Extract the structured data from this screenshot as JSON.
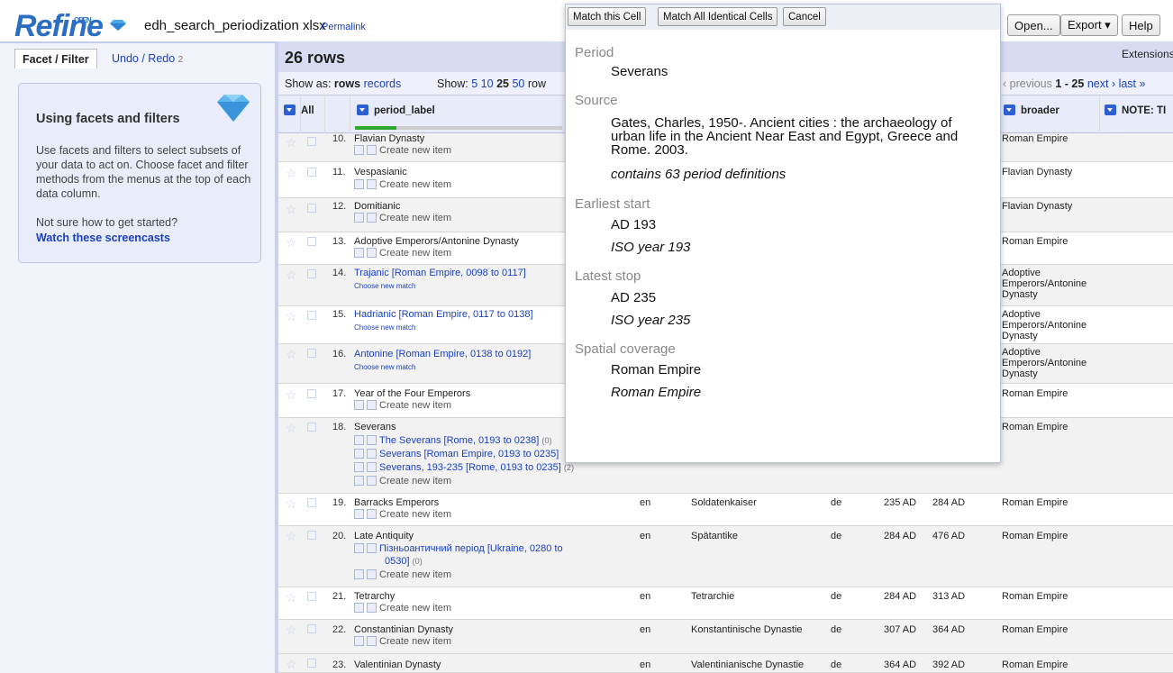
{
  "app": {
    "logo": "Refine",
    "logo_small": "OPEN",
    "project_name": "edh_search_periodization xlsx",
    "permalink": "Permalink"
  },
  "top_buttons": {
    "open": "Open...",
    "export": "Export ▾",
    "help": "Help"
  },
  "left": {
    "tab_facet": "Facet / Filter",
    "tab_undo": "Undo / Redo",
    "undo_count": "2",
    "help_title": "Using facets and filters",
    "help_text": "Use facets and filters to select subsets of your data to act on. Choose facet and filter methods from the menus at the top of each data column.",
    "help_q": "Not sure how to get started?",
    "help_link": "Watch these screencasts"
  },
  "grid": {
    "row_count": "26 rows",
    "show_as_label": "Show as:",
    "show_as_rows": "rows",
    "show_as_records": "records",
    "show_label": "Show:",
    "show_5": "5",
    "show_10": "10",
    "show_25": "25",
    "show_50": "50",
    "show_row": "row",
    "pager_prev": "‹ previous",
    "pager_range": "1 - 25",
    "pager_next": "next ›",
    "pager_last": "last »",
    "extensions": "Extensions:",
    "col_all": "All",
    "col_period": "period_label",
    "col_broader": "broader",
    "col_note": "NOTE: TI",
    "reconcile_progress": 0.2
  },
  "rows": [
    {
      "num": "10.",
      "label": "Flavian Dynasty",
      "sub": "Create new item",
      "broader": "Roman Empire"
    },
    {
      "num": "11.",
      "label": "Vespasianic",
      "sub": "Create new item",
      "broader": "Flavian Dynasty"
    },
    {
      "num": "12.",
      "label": "Domitianic",
      "sub": "Create new item",
      "broader": "Flavian Dynasty"
    },
    {
      "num": "13.",
      "label": "Adoptive Emperors/Antonine Dynasty",
      "sub": "Create new item",
      "broader": "Roman Empire"
    },
    {
      "num": "14.",
      "label": "Trajanic [Roman Empire, 0098 to 0117]",
      "sub": "Choose new match",
      "broader": "Adoptive Emperors/Antonine Dynasty"
    },
    {
      "num": "15.",
      "label": "Hadrianic [Roman Empire, 0117 to 0138]",
      "sub": "Choose new match",
      "broader": "Adoptive Emperors/Antonine Dynasty"
    },
    {
      "num": "16.",
      "label": "Antonine [Roman Empire, 0138 to 0192]",
      "sub": "Choose new match",
      "broader": "Adoptive Emperors/Antonine Dynasty"
    },
    {
      "num": "17.",
      "label": "Year of the Four Emperors",
      "sub": "Create new item",
      "broader": "Roman Empire"
    },
    {
      "num": "18.",
      "label": "Severans",
      "cand1": "The Severans [Rome, 0193 to 0238]",
      "cand1_score": "(0)",
      "cand2": "Severans [Roman Empire, 0193 to 0235]",
      "cand3": "Severans, 193-235 [Rome, 0193 to 0235]",
      "cand3_score": "(2)",
      "sub": "Create new item",
      "broader": "Roman Empire"
    },
    {
      "num": "19.",
      "label": "Barracks Emperors",
      "lang": "en",
      "de_label": "Soldatenkaiser",
      "lang2": "de",
      "start": "235 AD",
      "stop": "284 AD",
      "sub": "Create new item",
      "broader": "Roman Empire"
    },
    {
      "num": "20.",
      "label": "Late Antiquity",
      "cand1": "Пізньоантичний період [Ukraine, 0280 to",
      "cand1b": "0530]",
      "cand1_score": "(0)",
      "lang": "en",
      "de_label": "Spätantike",
      "lang2": "de",
      "start": "284 AD",
      "stop": "476 AD",
      "sub": "Create new item",
      "broader": "Roman Empire"
    },
    {
      "num": "21.",
      "label": "Tetrarchy",
      "lang": "en",
      "de_label": "Tetrarchie",
      "lang2": "de",
      "start": "284 AD",
      "stop": "313 AD",
      "sub": "Create new item",
      "broader": "Roman Empire"
    },
    {
      "num": "22.",
      "label": "Constantinian Dynasty",
      "lang": "en",
      "de_label": "Konstantinische Dynastie",
      "lang2": "de",
      "start": "307 AD",
      "stop": "364 AD",
      "sub": "Create new item",
      "broader": "Roman Empire"
    },
    {
      "num": "23.",
      "label": "Valentinian Dynasty",
      "lang": "en",
      "de_label": "Valentinianische Dynastie",
      "lang2": "de",
      "start": "364 AD",
      "stop": "392 AD",
      "broader": "Roman Empire"
    }
  ],
  "popup": {
    "btn_match": "Match this Cell",
    "btn_match_all": "Match All Identical Cells",
    "btn_cancel": "Cancel",
    "period_h": "Period",
    "period_v": "Severans",
    "source_h": "Source",
    "source_v": "Gates, Charles, 1950-. Ancient cities : the archaeology of urban life in the Ancient Near East and Egypt, Greece and Rome. 2003.",
    "source_count": "contains 63 period definitions",
    "start_h": "Earliest start",
    "start_v": "AD 193",
    "start_iso": "ISO year 193",
    "stop_h": "Latest stop",
    "stop_v": "AD 235",
    "stop_iso": "ISO year 235",
    "spatial_h": "Spatial coverage",
    "spatial_v": "Roman Empire",
    "spatial_i": "Roman Empire"
  }
}
